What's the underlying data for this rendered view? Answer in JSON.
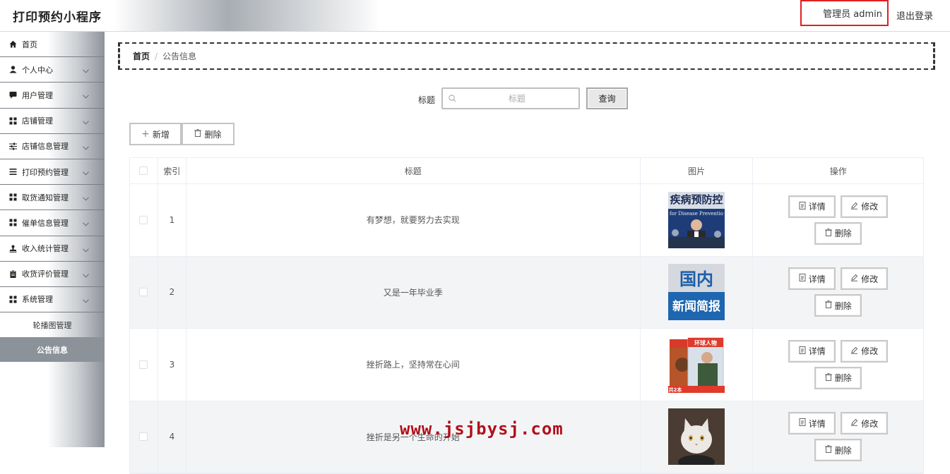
{
  "header": {
    "title": "打印预约小程序",
    "admin_label": "管理员 admin",
    "logout": "退出登录"
  },
  "sidebar": {
    "items": [
      {
        "label": "首页",
        "icon": "home-icon",
        "has_children": false
      },
      {
        "label": "个人中心",
        "icon": "user-icon",
        "has_children": true
      },
      {
        "label": "用户管理",
        "icon": "message-icon",
        "has_children": true
      },
      {
        "label": "店铺管理",
        "icon": "grid-icon",
        "has_children": true
      },
      {
        "label": "店铺信息管理",
        "icon": "sliders-icon",
        "has_children": true
      },
      {
        "label": "打印预约管理",
        "icon": "list-icon",
        "has_children": true
      },
      {
        "label": "取货通知管理",
        "icon": "grid-icon",
        "has_children": true
      },
      {
        "label": "催单信息管理",
        "icon": "grid-icon",
        "has_children": true
      },
      {
        "label": "收入统计管理",
        "icon": "stamp-icon",
        "has_children": true
      },
      {
        "label": "收货评价管理",
        "icon": "clipboard-icon",
        "has_children": true
      },
      {
        "label": "系统管理",
        "icon": "grid-icon",
        "has_children": true
      }
    ],
    "sub_items": [
      {
        "label": "轮播图管理",
        "active": false
      },
      {
        "label": "公告信息",
        "active": true
      }
    ]
  },
  "breadcrumb": {
    "home": "首页",
    "separator": "/",
    "current": "公告信息"
  },
  "search": {
    "label": "标题",
    "placeholder": "标题",
    "value": "",
    "button": "查询"
  },
  "actions": {
    "add": "新增",
    "delete": "删除"
  },
  "table": {
    "columns": [
      "",
      "索引",
      "标题",
      "图片",
      "操作"
    ],
    "rows": [
      {
        "index": "1",
        "title": "有梦想，就要努力去实现",
        "image": "disease-prevention-press-photo"
      },
      {
        "index": "2",
        "title": "又是一年毕业季",
        "image": "domestic-news-briefing"
      },
      {
        "index": "3",
        "title": "挫折路上，坚持常在心间",
        "image": "magazine-covers"
      },
      {
        "index": "4",
        "title": "挫折是另一个生命的开始",
        "image": "cat-photo"
      }
    ],
    "op_labels": {
      "detail": "详情",
      "edit": "修改",
      "delete": "删除"
    }
  },
  "image_texts": {
    "thumb1_line1": "疾病预防控",
    "thumb1_line2": "for Disease Preventio",
    "thumb2_line1": "国内",
    "thumb2_line2": "新闻简报",
    "thumb3_title": "环球人物",
    "thumb3_footer": "共2本"
  },
  "watermark": "www.jsjbysj.com",
  "colors": {
    "highlight": "#e02020",
    "active_menu": "#8c9299",
    "watermark": "#b0101a"
  }
}
